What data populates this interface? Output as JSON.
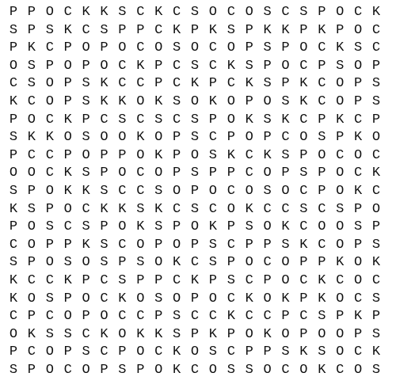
{
  "puzzle": {
    "rows": [
      "PPOCKKSCKCSOCOSCSPOCK",
      "SPSKCSPPCKPKSPKKPKPOC",
      "PKCPOPOCOSOCOPSPOCKSC",
      "OSPOPOCKPCSCKSPOCPSOP",
      "CSOPSKCCPCKPCKSPKCOPS",
      "KCOPSKKOKSOKOPOSKCOPS",
      "POCKPCSCSCSPOKSKCPKCP",
      "SKKOSOOKOPSCPOPCOSPKO",
      "PCCPOPPOKPOSKCKSPOCOC",
      "OOCKSPOCOPSPPCOPSPOCK",
      "SPOKKSCCSOPOCOSOCPOKC",
      "KSPOCKKSKCSCOKCCSCSPO",
      "POSCSPOKSPOKPSOKCOOSP",
      "COPPKSCOPOPSCPPSKCOPS",
      "SPOSOSPSOKCSPOCOPPKOK",
      "KCCKPCSPPCKPSCPOCKCOC",
      "KOSPOCKOSOPOCKOKPKOCS",
      "CPCOPOCCPSCCKCCPCSPKP",
      "OKSSCKOKKSPKPOKOPOOPS",
      "PCOPSCPOCKOSCPPSKSOCK",
      "SPOCOPSPOKCOSSOCOKCOS"
    ]
  }
}
